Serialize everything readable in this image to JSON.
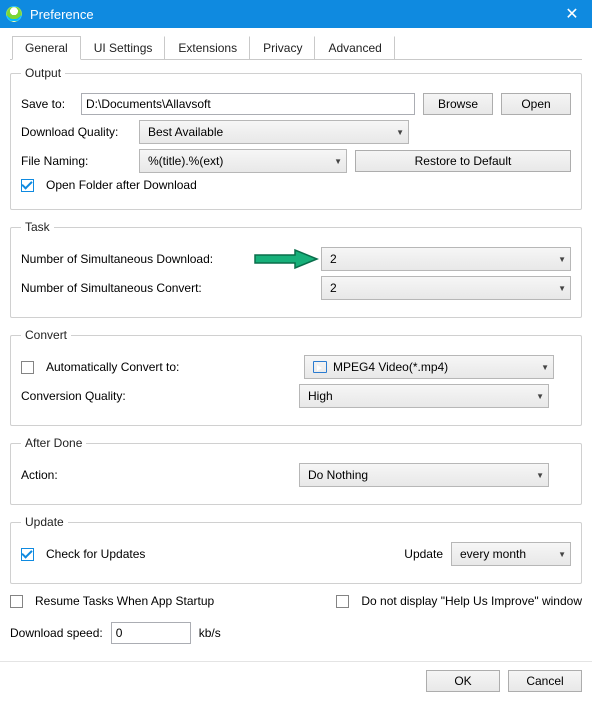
{
  "window": {
    "title": "Preference",
    "close": "✕"
  },
  "tabs": {
    "general": "General",
    "ui": "UI Settings",
    "ext": "Extensions",
    "priv": "Privacy",
    "adv": "Advanced"
  },
  "output": {
    "legend": "Output",
    "save_to_label": "Save to:",
    "save_to_value": "D:\\Documents\\Allavsoft",
    "browse": "Browse",
    "open": "Open",
    "quality_label": "Download Quality:",
    "quality_value": "Best Available",
    "naming_label": "File Naming:",
    "naming_value": "%(title).%(ext)",
    "restore": "Restore to Default",
    "open_folder_label": "Open Folder after Download"
  },
  "task": {
    "legend": "Task",
    "dl_label": "Number of Simultaneous Download:",
    "dl_value": "2",
    "cv_label": "Number of Simultaneous Convert:",
    "cv_value": "2"
  },
  "convert": {
    "legend": "Convert",
    "auto_label": "Automatically Convert to:",
    "format_value": "MPEG4 Video(*.mp4)",
    "qual_label": "Conversion Quality:",
    "qual_value": "High"
  },
  "afterdone": {
    "legend": "After Done",
    "action_label": "Action:",
    "action_value": "Do Nothing"
  },
  "update": {
    "legend": "Update",
    "check_label": "Check for Updates",
    "upd_label": "Update",
    "upd_value": "every month"
  },
  "misc": {
    "resume": "Resume Tasks When App Startup",
    "noHelp": "Do not display \"Help Us Improve\" window",
    "speed_label": "Download speed:",
    "speed_value": "0",
    "speed_unit": "kb/s"
  },
  "footer": {
    "ok": "OK",
    "cancel": "Cancel"
  }
}
